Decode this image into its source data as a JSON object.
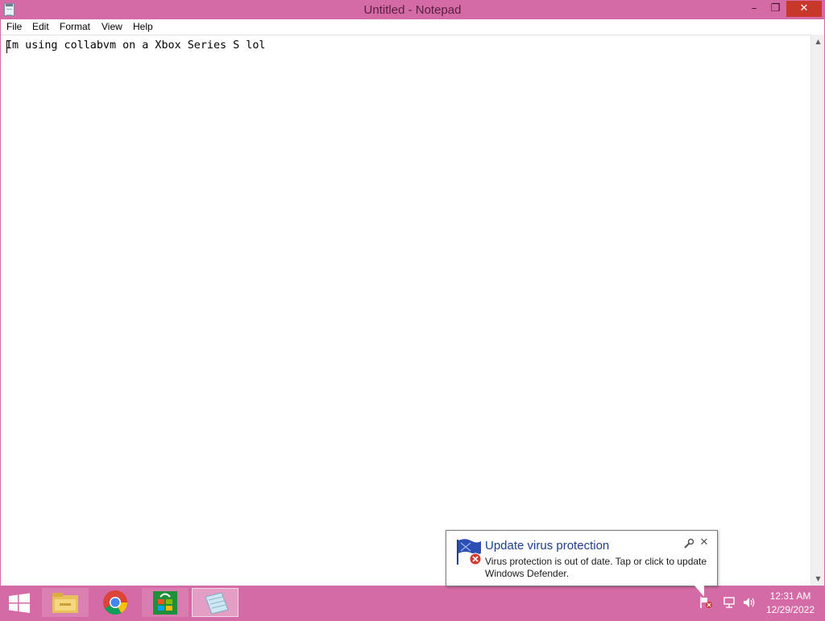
{
  "window": {
    "title": "Untitled - Notepad",
    "minimize_glyph": "–",
    "maximize_glyph": "❐",
    "close_glyph": "✕"
  },
  "menu": {
    "items": [
      "File",
      "Edit",
      "Format",
      "View",
      "Help"
    ]
  },
  "editor": {
    "text": "Im using collabvm on a Xbox Series S lol"
  },
  "notification": {
    "title": "Update virus protection",
    "body": "Virus protection is out of date. Tap or click to update Windows Defender.",
    "close_glyph": "✕"
  },
  "taskbar": {
    "pinned": [
      "file-explorer-icon",
      "chrome-icon",
      "store-icon",
      "notepad-icon"
    ],
    "active_app": "notepad-icon",
    "tray": [
      "action-center-flag-icon",
      "network-icon",
      "volume-icon"
    ],
    "clock": {
      "time": "12:31 AM",
      "date": "12/29/2022"
    }
  },
  "colors": {
    "accent": "#d46aa6",
    "close_button": "#c7372a",
    "toast_title": "#1e3f8c"
  }
}
